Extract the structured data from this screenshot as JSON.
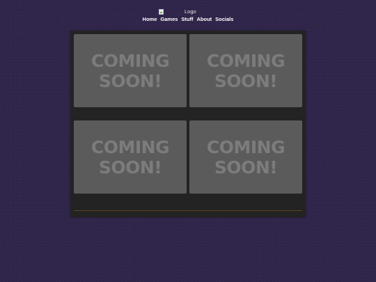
{
  "header": {
    "logo_alt": "Logo"
  },
  "nav": {
    "items": [
      {
        "label": "Home"
      },
      {
        "label": "Games"
      },
      {
        "label": "Stuff"
      },
      {
        "label": "About"
      },
      {
        "label": "Socials"
      }
    ]
  },
  "tiles": [
    {
      "label": "COMING\nSOON!"
    },
    {
      "label": "COMING\nSOON!"
    },
    {
      "label": "COMING\nSOON!"
    },
    {
      "label": "COMING\nSOON!"
    }
  ],
  "colors": {
    "background": "#2e2349",
    "panel": "#232323",
    "tile": "#5b5b5b",
    "tile_text": "#7c7c7c",
    "nav_text": "#ffffff"
  }
}
